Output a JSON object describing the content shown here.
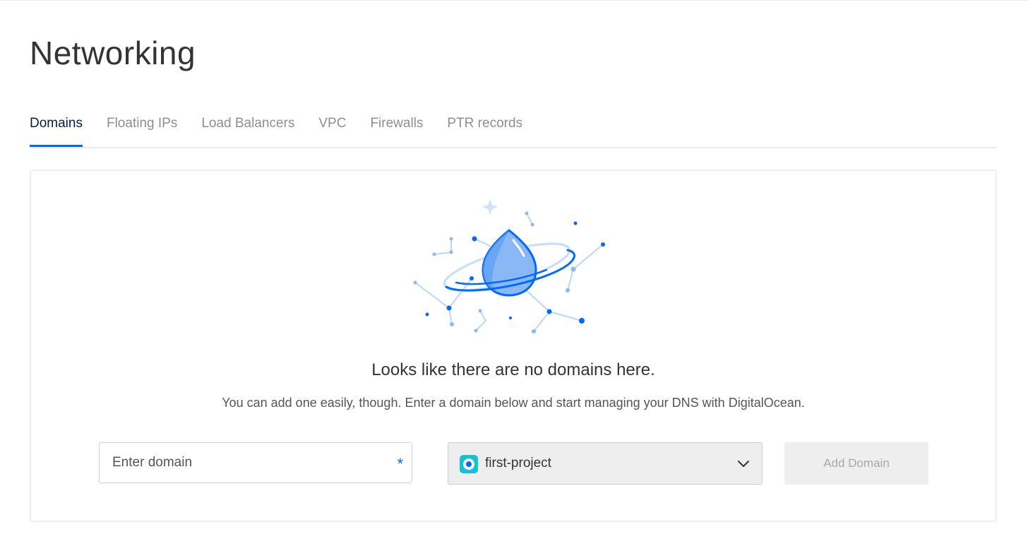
{
  "page": {
    "title": "Networking"
  },
  "tabs": [
    {
      "label": "Domains",
      "active": true
    },
    {
      "label": "Floating IPs",
      "active": false
    },
    {
      "label": "Load Balancers",
      "active": false
    },
    {
      "label": "VPC",
      "active": false
    },
    {
      "label": "Firewalls",
      "active": false
    },
    {
      "label": "PTR records",
      "active": false
    }
  ],
  "empty_state": {
    "illustration_icon": "droplet-planet-illustration",
    "title": "Looks like there are no domains here.",
    "description": "You can add one easily, though. Enter a domain below and start managing your DNS with DigitalOcean."
  },
  "domain_form": {
    "domain_input": {
      "placeholder": "Enter domain",
      "value": "",
      "required_mark": "*"
    },
    "project_select": {
      "selected": "first-project",
      "icon": "project-icon"
    },
    "submit_label": "Add Domain"
  },
  "colors": {
    "accent": "#0069ff",
    "active_tab_text": "#031b4e",
    "inactive_tab_text": "#8e8e8e",
    "project_icon": "#16c1d4",
    "disabled_button_bg": "#eeeeee",
    "disabled_button_text": "#a8a8a8"
  }
}
